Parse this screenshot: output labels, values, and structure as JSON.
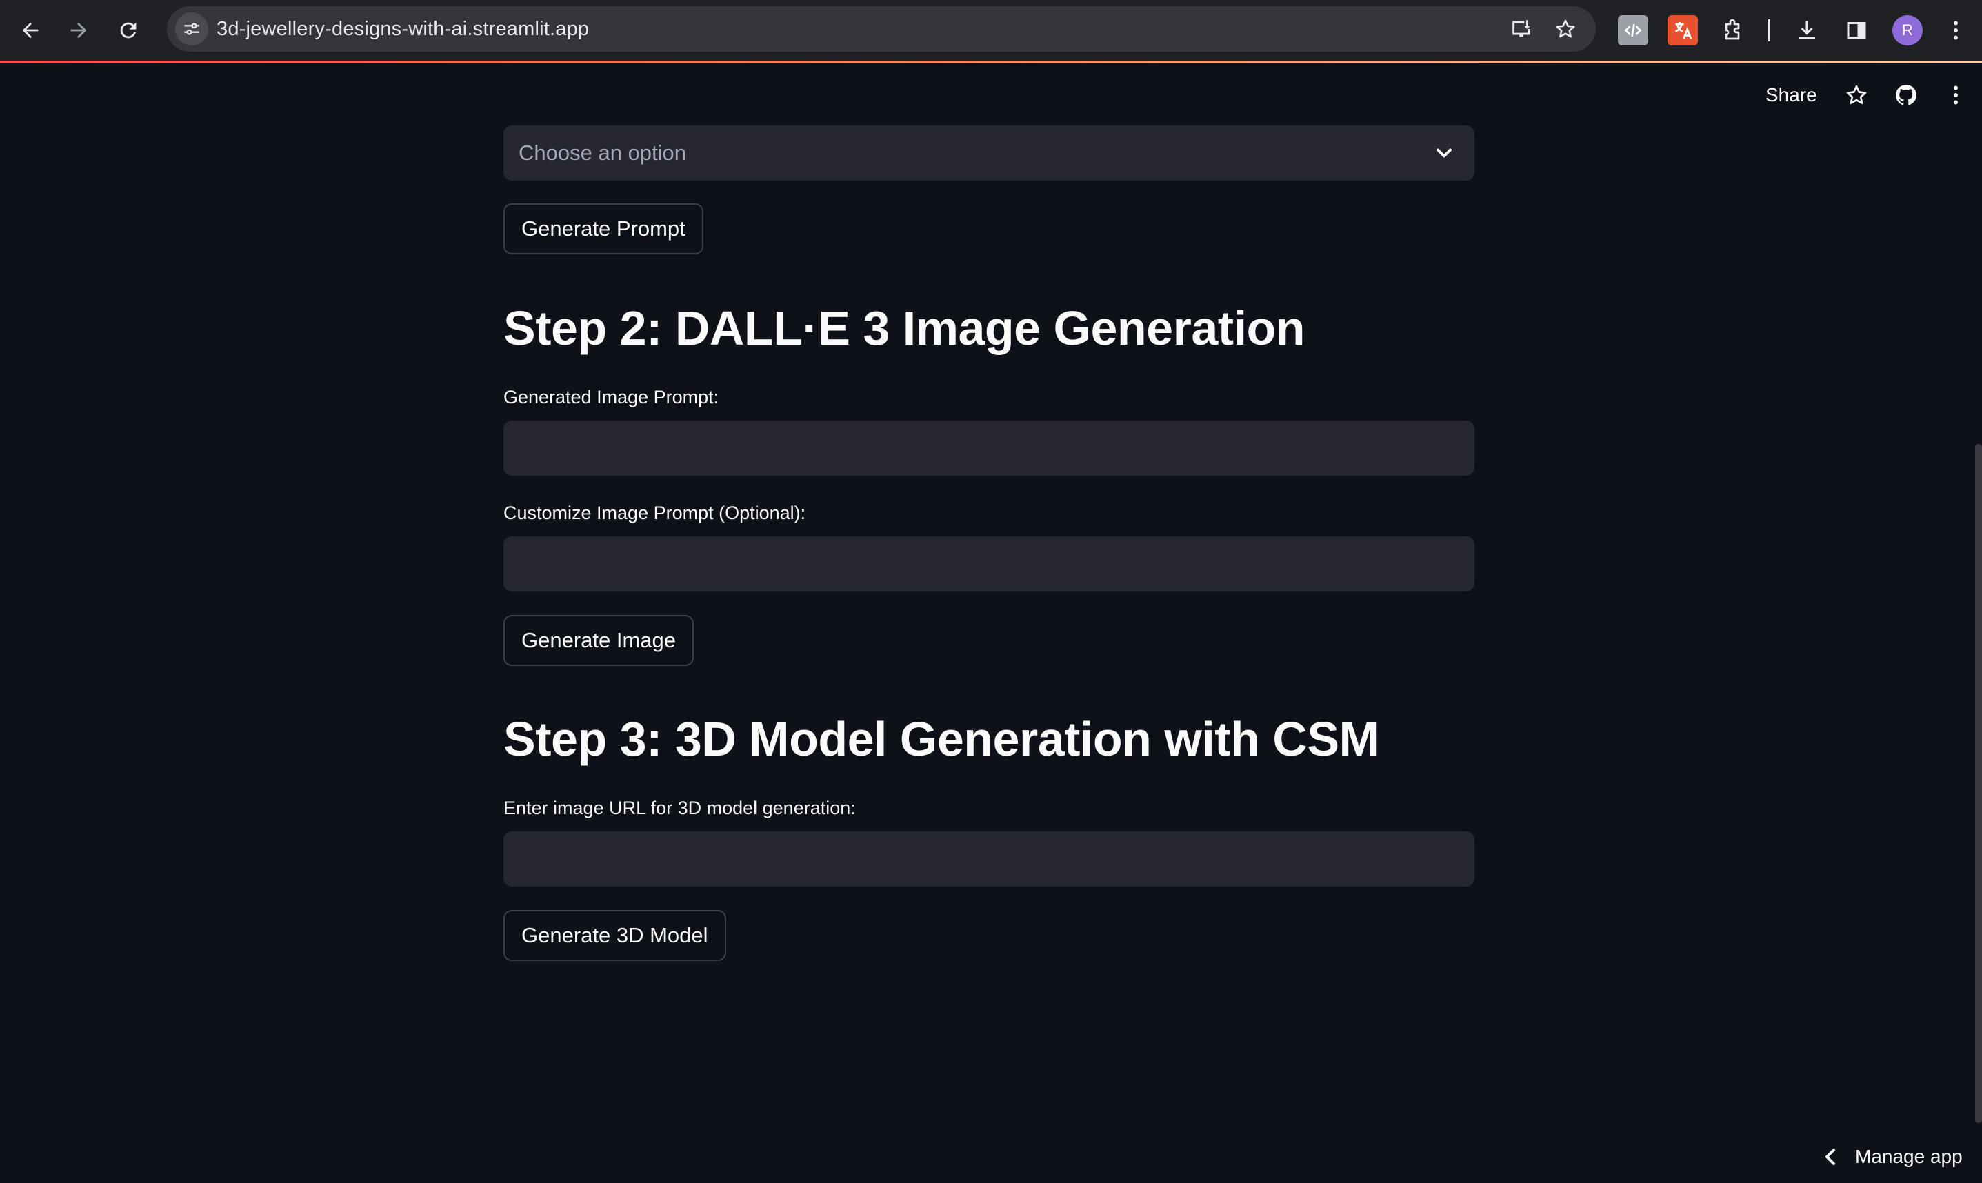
{
  "browser": {
    "url": "3d-jewellery-designs-with-ai.streamlit.app",
    "profile_initial": "R",
    "icons": {
      "back": "arrow-left-icon",
      "forward": "arrow-right-icon",
      "reload": "reload-icon",
      "site_info": "tune-icon",
      "install": "install-app-icon",
      "bookmark": "star-icon",
      "ext_devtools": "code-icon",
      "ext_translate": "translate-icon",
      "extensions": "puzzle-icon",
      "downloads": "download-icon",
      "side_panel": "side-panel-icon",
      "menu": "kebab-menu-icon"
    }
  },
  "header": {
    "share_label": "Share",
    "icons": {
      "star": "star-icon",
      "github": "github-icon",
      "menu": "kebab-menu-icon"
    }
  },
  "main": {
    "select": {
      "placeholder": "Choose an option"
    },
    "generate_prompt_label": "Generate Prompt",
    "step2": {
      "title": "Step 2: DALL·E 3 Image Generation",
      "generated_prompt_label": "Generated Image Prompt:",
      "generated_prompt_value": "",
      "customize_prompt_label": "Customize Image Prompt (Optional):",
      "customize_prompt_value": "",
      "generate_image_label": "Generate Image"
    },
    "step3": {
      "title": "Step 3: 3D Model Generation with CSM",
      "image_url_label": "Enter image URL for 3D model generation:",
      "image_url_value": "",
      "generate_model_label": "Generate 3D Model"
    }
  },
  "footer": {
    "manage_app_label": "Manage app"
  },
  "colors": {
    "page_bg": "#0e1117",
    "input_bg": "#262730",
    "text": "#fafafa",
    "chrome_bg": "#202124",
    "accent": "#ff4b4b"
  }
}
